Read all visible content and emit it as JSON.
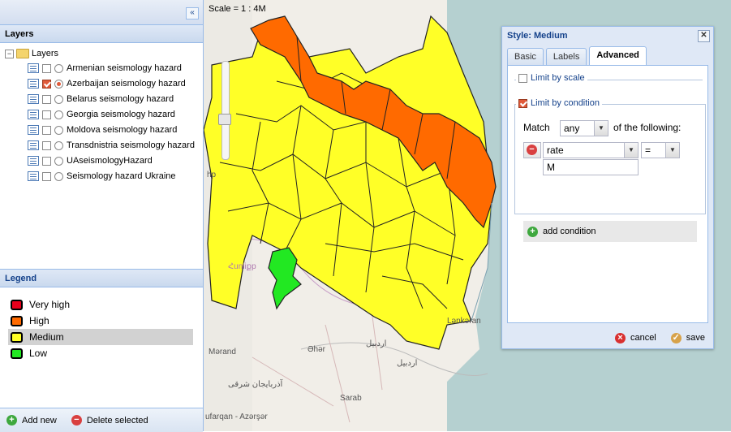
{
  "layers_panel": {
    "title": "Layers",
    "collapse_glyph": "«",
    "root_label": "Layers",
    "items": [
      {
        "label": "Armenian seismology hazard",
        "checked": false,
        "selected": false
      },
      {
        "label": "Azerbaijan seismology hazard",
        "checked": true,
        "selected": true
      },
      {
        "label": "Belarus seismology hazard",
        "checked": false,
        "selected": false
      },
      {
        "label": "Georgia seismology hazard",
        "checked": false,
        "selected": false
      },
      {
        "label": "Moldova seismology hazard",
        "checked": false,
        "selected": false
      },
      {
        "label": "Transdnistria seismology hazard",
        "checked": false,
        "selected": false
      },
      {
        "label": "UAseismologyHazard",
        "checked": false,
        "selected": false
      },
      {
        "label": "Seismology hazard Ukraine",
        "checked": false,
        "selected": false
      }
    ]
  },
  "legend_panel": {
    "title": "Legend",
    "items": [
      {
        "label": "Very high",
        "color": "#e8001c"
      },
      {
        "label": "High",
        "color": "#ff6a00"
      },
      {
        "label": "Medium",
        "color": "#ffff27"
      },
      {
        "label": "Low",
        "color": "#22e822"
      }
    ],
    "selected_index": 2
  },
  "footer": {
    "add_label": "Add new",
    "delete_label": "Delete selected"
  },
  "map": {
    "scale": "Scale = 1 : 4M",
    "labels": {
      "h1": "hp",
      "armenia": "Հunliքp",
      "lankaran": "Lənkəran",
      "merand": "Mərand",
      "ahar": "Əhər",
      "ardabil_fa": "اردبیل",
      "ardabil_fa2": "اردبیل",
      "azar": "آذربایجان شرقی",
      "sarab": "Sarab",
      "azarsark": "ufarqan - Azərşər"
    }
  },
  "style_dialog": {
    "title": "Style: Medium",
    "close_glyph": "✕",
    "tabs": [
      "Basic",
      "Labels",
      "Advanced"
    ],
    "active_tab": "Advanced",
    "limit_by_scale": {
      "label": "Limit by scale",
      "checked": false
    },
    "limit_by_condition": {
      "label": "Limit by condition",
      "checked": true
    },
    "match_label": "Match",
    "match_value": "any",
    "following_label": "of the following:",
    "filter": {
      "attribute": "rate",
      "operator": "=",
      "value": "M"
    },
    "add_condition": "add condition",
    "cancel": "cancel",
    "save": "save"
  }
}
